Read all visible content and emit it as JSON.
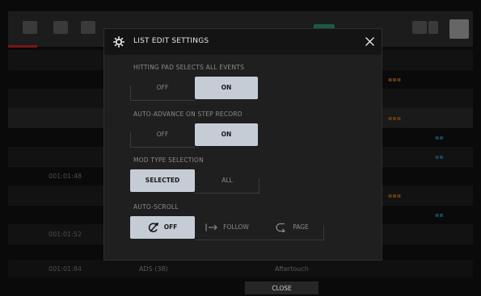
{
  "dialog": {
    "title": "LIST EDIT SETTINGS",
    "title_icon": "gear-icon",
    "close_icon": "close-icon"
  },
  "sections": {
    "hitting_pad": {
      "label": "HITTING PAD SELECTS ALL EVENTS",
      "options": [
        "OFF",
        "ON"
      ],
      "selected": "ON"
    },
    "auto_advance": {
      "label": "AUTO-ADVANCE ON STEP RECORD",
      "options": [
        "OFF",
        "ON"
      ],
      "selected": "ON"
    },
    "mod_type": {
      "label": "MOD TYPE SELECTION",
      "options": [
        "SELECTED",
        "ALL"
      ],
      "selected": "SELECTED"
    },
    "auto_scroll": {
      "label": "AUTO-SCROLL",
      "options": [
        {
          "label": "OFF",
          "icon": "scroll-off-icon"
        },
        {
          "label": "FOLLOW",
          "icon": "follow-arrow-icon"
        },
        {
          "label": "PAGE",
          "icon": "page-icon"
        }
      ],
      "selected": "OFF"
    }
  },
  "background": {
    "rows": [
      {
        "num": "",
        "pos": ""
      },
      {
        "num": "",
        "pos": ""
      },
      {
        "num": "",
        "pos": ""
      },
      {
        "num": "",
        "pos": ""
      },
      {
        "num": "",
        "pos": ""
      },
      {
        "num": "",
        "pos": ""
      },
      {
        "num": "",
        "pos": "001:01:48"
      },
      {
        "num": "",
        "pos": ""
      },
      {
        "num": "",
        "pos": ""
      },
      {
        "num": "",
        "pos": "001:01:52"
      },
      {
        "num": "",
        "pos": "001:01:84"
      }
    ],
    "bottom": {
      "value1": "ADS (38)",
      "value2": "Aftertouch"
    }
  },
  "footer": {
    "close_label": "CLOSE"
  },
  "colors": {
    "selected_bg": "#c5ccd6",
    "dialog_bg": "#1f1f1f",
    "header_bg": "#141414"
  }
}
